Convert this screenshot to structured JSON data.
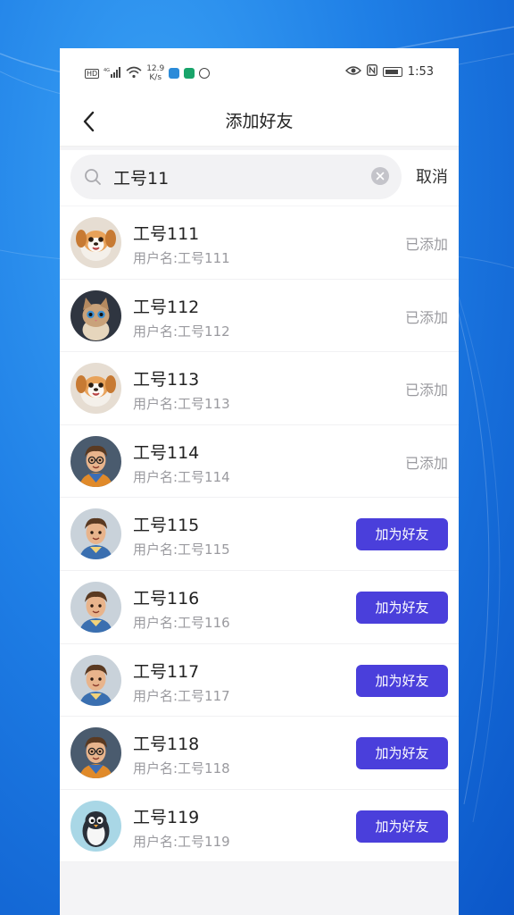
{
  "status_bar": {
    "left_badges": [
      "HD",
      "4G"
    ],
    "net_speed": "12.9",
    "net_speed_unit": "K/s",
    "time": "1:53"
  },
  "nav": {
    "title": "添加好友",
    "back_icon": "chevron-left-icon"
  },
  "search": {
    "value": "工号11",
    "placeholder": "",
    "cancel_label": "取消"
  },
  "results": [
    {
      "name": "工号111",
      "username": "用户名:工号111",
      "avatar": "puppy-avatar",
      "status": "added",
      "action_label": "已添加"
    },
    {
      "name": "工号112",
      "username": "用户名:工号112",
      "avatar": "kitten-avatar",
      "status": "added",
      "action_label": "已添加"
    },
    {
      "name": "工号113",
      "username": "用户名:工号113",
      "avatar": "puppy-avatar",
      "status": "added",
      "action_label": "已添加"
    },
    {
      "name": "工号114",
      "username": "用户名:工号114",
      "avatar": "boy-glasses-avatar",
      "status": "added",
      "action_label": "已添加"
    },
    {
      "name": "工号115",
      "username": "用户名:工号115",
      "avatar": "boy-avatar",
      "status": "add",
      "action_label": "加为好友"
    },
    {
      "name": "工号116",
      "username": "用户名:工号116",
      "avatar": "boy-avatar",
      "status": "add",
      "action_label": "加为好友"
    },
    {
      "name": "工号117",
      "username": "用户名:工号117",
      "avatar": "boy-avatar",
      "status": "add",
      "action_label": "加为好友"
    },
    {
      "name": "工号118",
      "username": "用户名:工号118",
      "avatar": "boy-glasses-avatar",
      "status": "add",
      "action_label": "加为好友"
    },
    {
      "name": "工号119",
      "username": "用户名:工号119",
      "avatar": "penguin-avatar",
      "status": "add",
      "action_label": "加为好友"
    }
  ],
  "colors": {
    "primary_button": "#4a3fdb",
    "added_text": "#9a9a9f",
    "background": "#f4f4f6"
  }
}
